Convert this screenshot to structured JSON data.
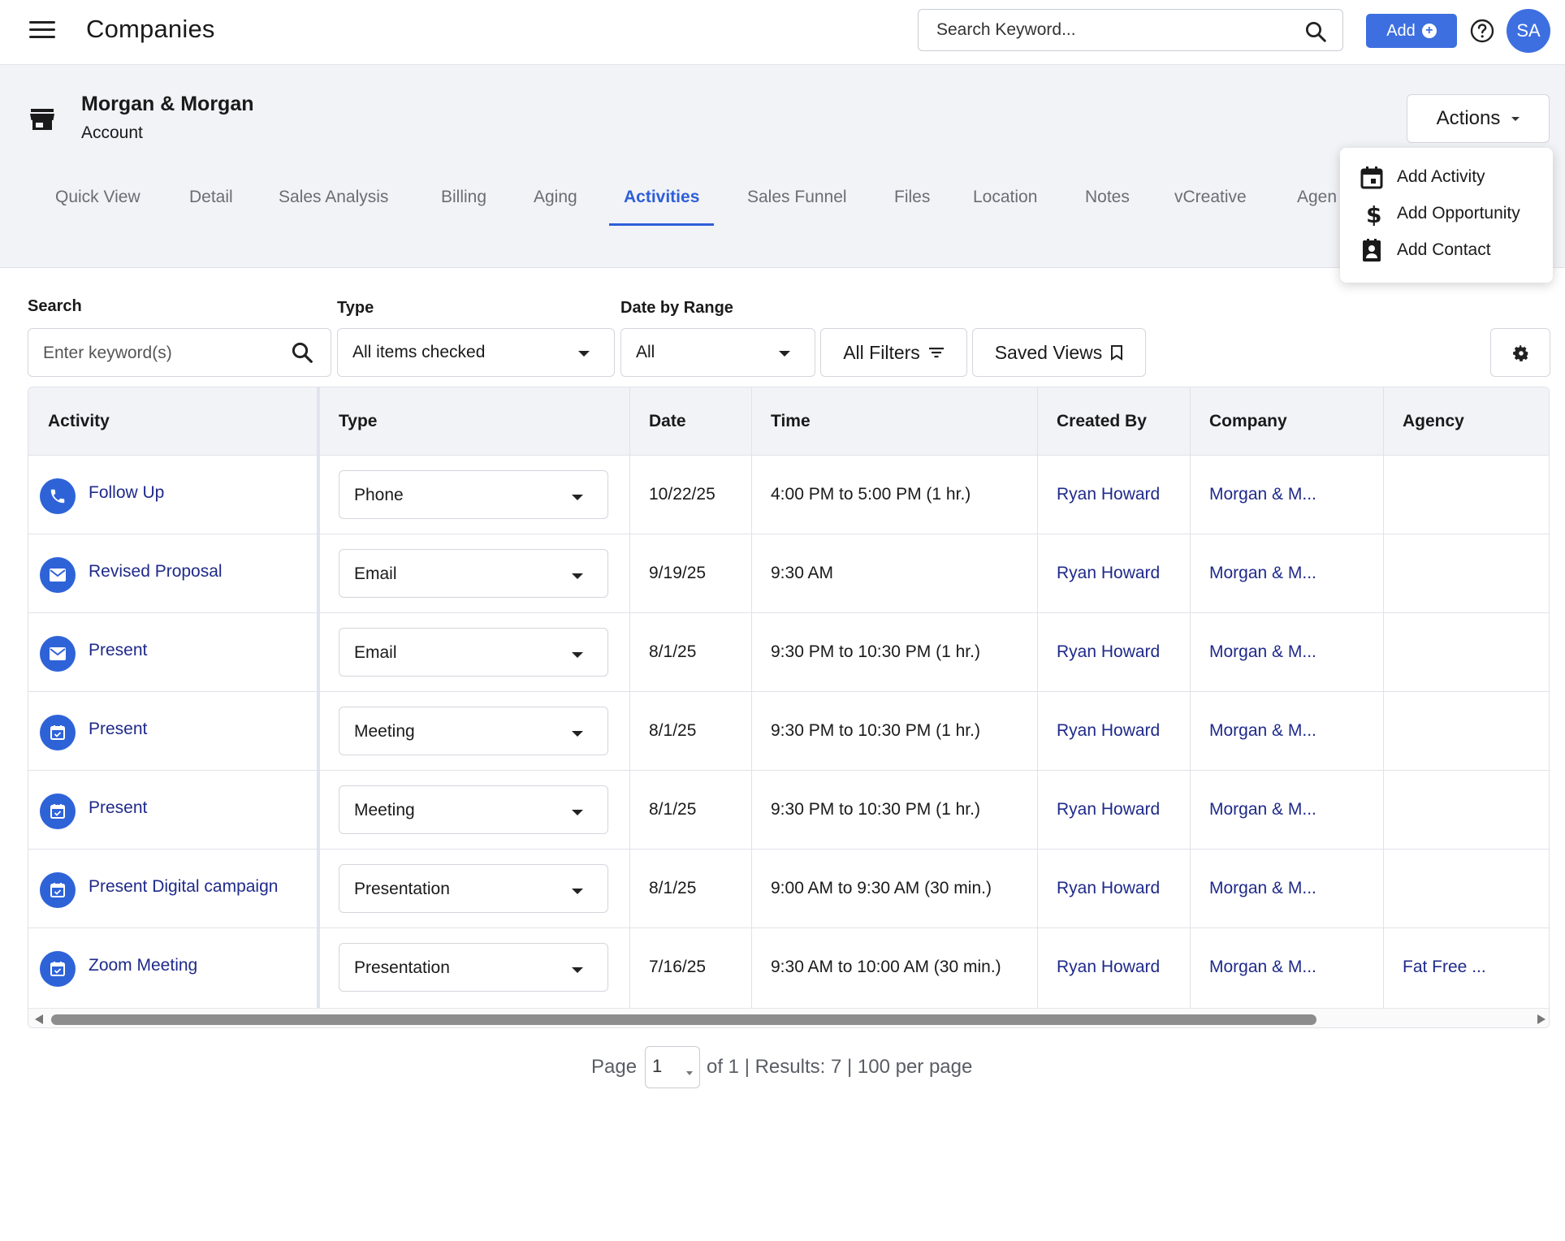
{
  "app": {
    "title": "Companies"
  },
  "topbar": {
    "search_placeholder": "Search Keyword...",
    "add_label": "Add",
    "avatar_initials": "SA"
  },
  "company": {
    "name": "Morgan & Morgan",
    "type": "Account"
  },
  "actions": {
    "label": "Actions",
    "menu": [
      {
        "label": "Add Activity",
        "icon": "calendar-icon"
      },
      {
        "label": "Add Opportunity",
        "icon": "dollar-icon"
      },
      {
        "label": "Add Contact",
        "icon": "contact-card-icon"
      }
    ]
  },
  "tabs": [
    {
      "label": "Quick View"
    },
    {
      "label": "Detail"
    },
    {
      "label": "Sales Analysis"
    },
    {
      "label": "Billing"
    },
    {
      "label": "Aging"
    },
    {
      "label": "Activities",
      "active": true
    },
    {
      "label": "Sales Funnel"
    },
    {
      "label": "Files"
    },
    {
      "label": "Location"
    },
    {
      "label": "Notes"
    },
    {
      "label": "vCreative"
    },
    {
      "label": "Agen"
    }
  ],
  "filters": {
    "search_label": "Search",
    "search_placeholder": "Enter keyword(s)",
    "type_label": "Type",
    "type_value": "All items checked",
    "date_label": "Date by Range",
    "date_value": "All",
    "all_filters_label": "All Filters",
    "saved_views_label": "Saved Views"
  },
  "table": {
    "columns": [
      "Activity",
      "Type",
      "Date",
      "Time",
      "Created By",
      "Company",
      "Agency"
    ],
    "rows": [
      {
        "icon": "phone-icon",
        "activity": "Follow Up",
        "type": "Phone",
        "date": "10/22/25",
        "time": "4:00 PM to 5:00 PM (1 hr.)",
        "created_by": "Ryan Howard",
        "company": "Morgan & M...",
        "agency": ""
      },
      {
        "icon": "email-icon",
        "activity": "Revised Proposal",
        "type": "Email",
        "date": "9/19/25",
        "time": "9:30 AM",
        "created_by": "Ryan Howard",
        "company": "Morgan & M...",
        "agency": ""
      },
      {
        "icon": "email-icon",
        "activity": "Present",
        "type": "Email",
        "date": "8/1/25",
        "time": "9:30 PM to 10:30 PM (1 hr.)",
        "created_by": "Ryan Howard",
        "company": "Morgan & M...",
        "agency": ""
      },
      {
        "icon": "calendar-check-icon",
        "activity": "Present",
        "type": "Meeting",
        "date": "8/1/25",
        "time": "9:30 PM to 10:30 PM (1 hr.)",
        "created_by": "Ryan Howard",
        "company": "Morgan & M...",
        "agency": ""
      },
      {
        "icon": "calendar-check-icon",
        "activity": "Present",
        "type": "Meeting",
        "date": "8/1/25",
        "time": "9:30 PM to 10:30 PM (1 hr.)",
        "created_by": "Ryan Howard",
        "company": "Morgan & M...",
        "agency": ""
      },
      {
        "icon": "calendar-check-icon",
        "activity": "Present Digital campaign",
        "type": "Presentation",
        "date": "8/1/25",
        "time": "9:00 AM to 9:30 AM (30 min.)",
        "created_by": "Ryan Howard",
        "company": "Morgan & M...",
        "agency": ""
      },
      {
        "icon": "calendar-check-icon",
        "activity": "Zoom Meeting",
        "type": "Presentation",
        "date": "7/16/25",
        "time": "9:30 AM to 10:00 AM (30 min.)",
        "created_by": "Ryan Howard",
        "company": "Morgan & M...",
        "agency": "Fat Free ..."
      }
    ]
  },
  "pagination": {
    "page_label": "Page",
    "page_value": "1",
    "summary": "of 1 | Results: 7 | 100 per page"
  },
  "colors": {
    "accent": "#3d6fe0",
    "link": "#1f2a8a",
    "header_bg": "#f2f3f7"
  }
}
